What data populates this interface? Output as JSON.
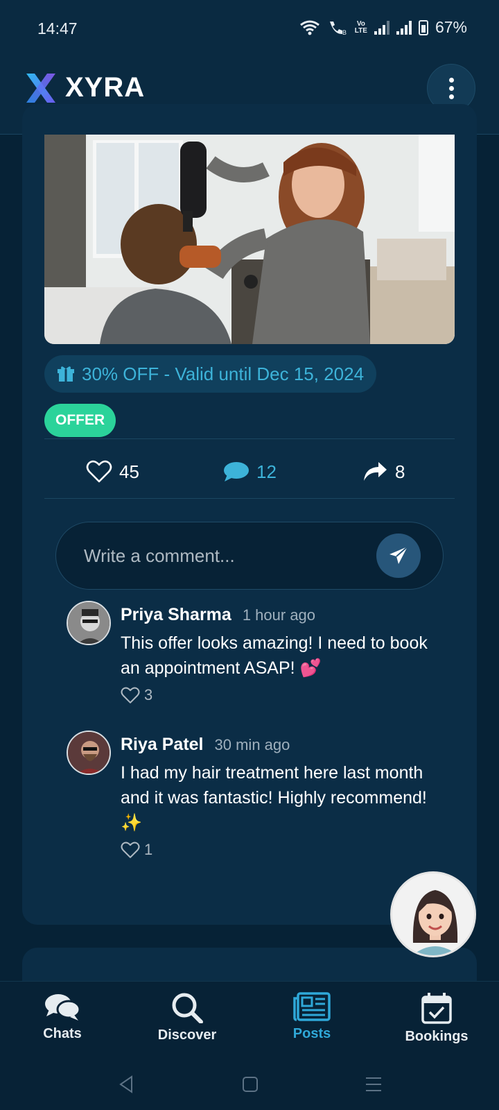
{
  "status_bar": {
    "time": "14:47",
    "battery": "67%"
  },
  "header": {
    "brand": "XYRA"
  },
  "post": {
    "offer_text": "30% OFF - Valid until Dec 15, 2024",
    "tag": "OFFER",
    "likes": "45",
    "comments": "12",
    "shares": "8"
  },
  "comment_input": {
    "placeholder": "Write a comment..."
  },
  "comments": [
    {
      "name": "Priya Sharma",
      "time": "1 hour ago",
      "text": "This offer looks amazing! I need to book an appointment ASAP! 💕",
      "likes": "3"
    },
    {
      "name": "Riya Patel",
      "time": "30 min ago",
      "text": "I had my hair treatment here last month and it was fantastic! Highly recommend! ✨",
      "likes": "1"
    }
  ],
  "nav": [
    {
      "label": "Chats",
      "icon": "chat-bubbles-icon"
    },
    {
      "label": "Discover",
      "icon": "search-icon"
    },
    {
      "label": "Posts",
      "icon": "newspaper-icon",
      "active": true
    },
    {
      "label": "Bookings",
      "icon": "calendar-check-icon"
    }
  ],
  "colors": {
    "background": "#062236",
    "card": "#0b2d46",
    "accent": "#2fa8d8",
    "offer_tag": "#2bd39a"
  }
}
